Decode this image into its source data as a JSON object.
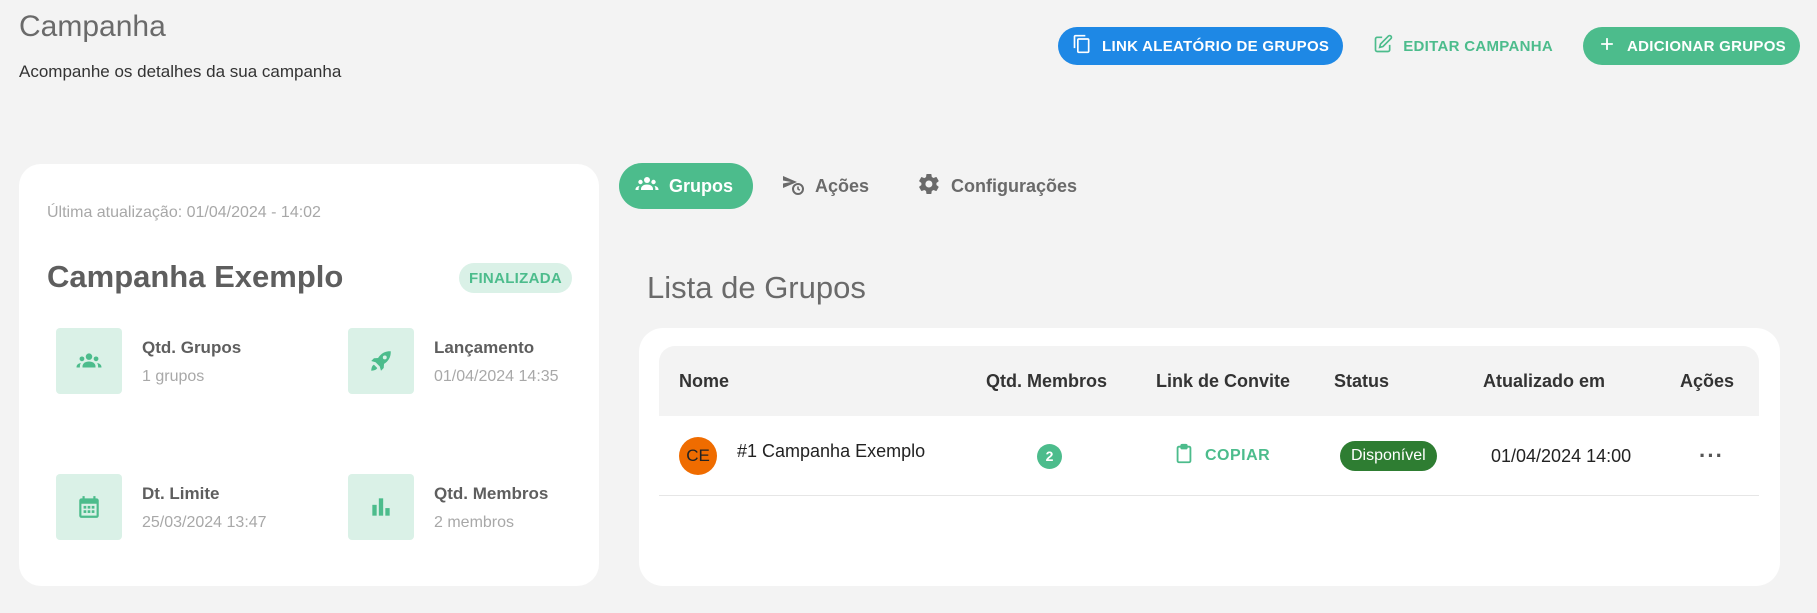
{
  "header": {
    "title": "Campanha",
    "subtitle": "Acompanhe os detalhes da sua campanha",
    "buttons": {
      "random_link": "LINK ALEATÓRIO DE GRUPOS",
      "edit": "EDITAR CAMPANHA",
      "add": "ADICIONAR GRUPOS"
    }
  },
  "campaign": {
    "updated": "Última atualização: 01/04/2024 - 14:02",
    "name": "Campanha Exemplo",
    "status_badge": "FINALIZADA",
    "stats": [
      {
        "label": "Qtd. Grupos",
        "value": "1 grupos",
        "icon": "groups-icon"
      },
      {
        "label": "Lançamento",
        "value": "01/04/2024 14:35",
        "icon": "rocket-icon"
      },
      {
        "label": "Dt. Limite",
        "value": "25/03/2024 13:47",
        "icon": "calendar-icon"
      },
      {
        "label": "Qtd. Membros",
        "value": "2 membros",
        "icon": "bar-chart-icon"
      }
    ]
  },
  "tabs": [
    {
      "label": "Grupos",
      "icon": "groups-icon",
      "active": true
    },
    {
      "label": "Ações",
      "icon": "scheduled-send-icon",
      "active": false
    },
    {
      "label": "Configurações",
      "icon": "gear-icon",
      "active": false
    }
  ],
  "groups_list": {
    "title": "Lista de Grupos",
    "columns": [
      "Nome",
      "Qtd. Membros",
      "Link de Convite",
      "Status",
      "Atualizado em",
      "Ações"
    ],
    "rows": [
      {
        "avatar": "CE",
        "name": "#1 Campanha Exemplo",
        "members": "2",
        "invite": "COPIAR",
        "status": "Disponível",
        "updated_at": "01/04/2024 14:00",
        "actions": "···"
      }
    ]
  },
  "colors": {
    "primary_green": "#4cbc8c",
    "light_green": "#daf1e7",
    "blue": "#1e88e5",
    "status_green": "#2e7d32",
    "avatar_orange": "#ef6c00",
    "background": "#f3f3f3"
  }
}
